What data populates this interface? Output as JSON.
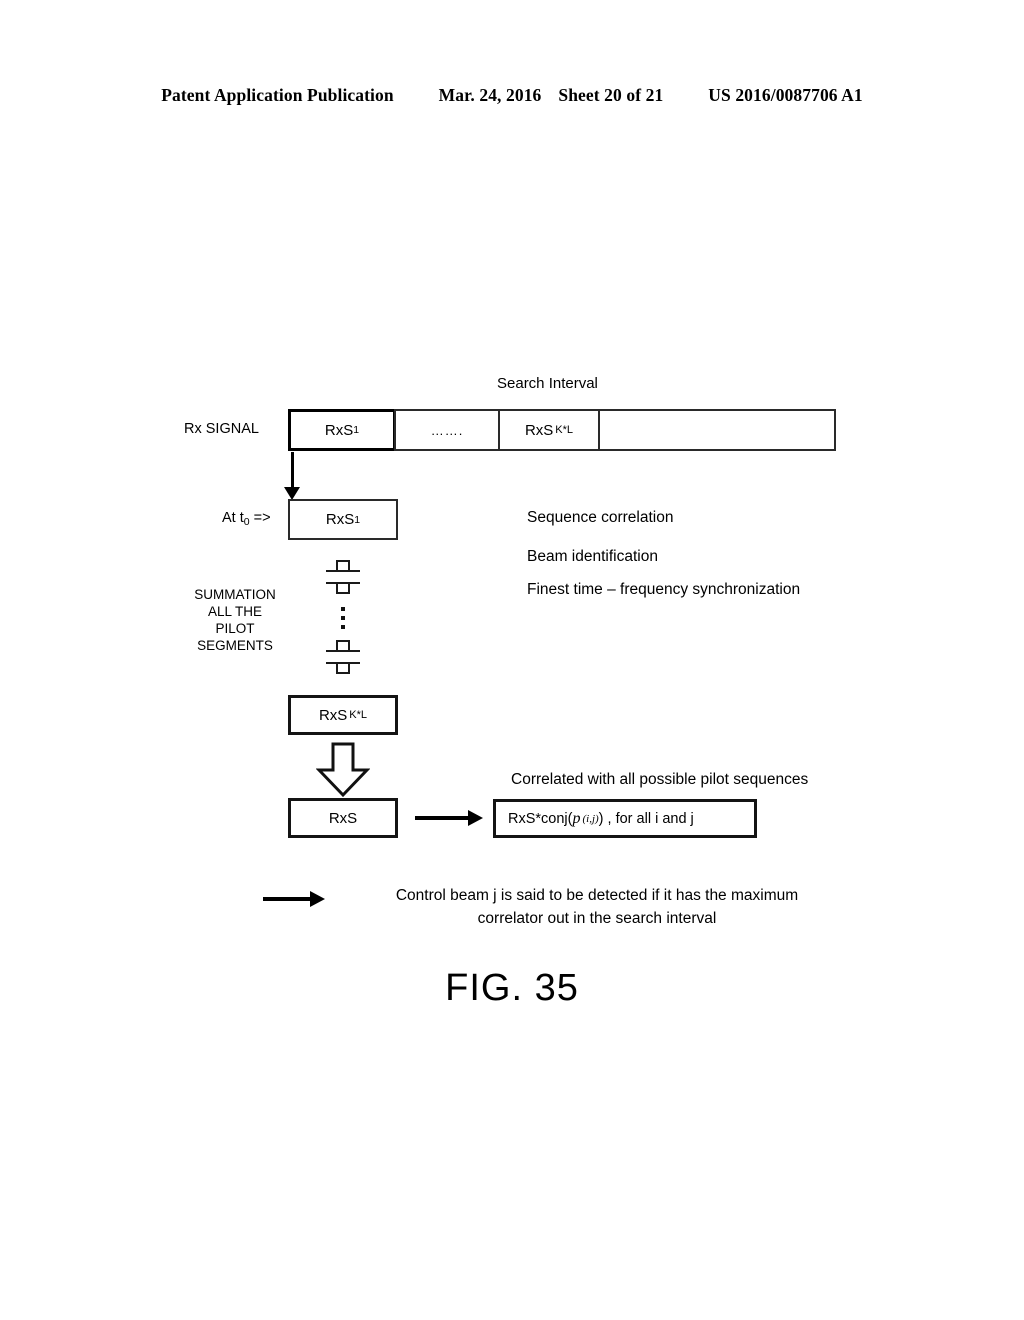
{
  "header": {
    "publication": "Patent Application Publication",
    "date": "Mar. 24, 2016",
    "sheet": "Sheet 20 of 21",
    "patent_number": "US 2016/0087706 A1"
  },
  "figure": {
    "caption": "FIG. 35",
    "search_interval_label": "Search Interval",
    "rx_signal_label": "Rx SIGNAL",
    "at_t0_label": "At  t",
    "at_t0_sub": "0",
    "at_t0_suffix": " =>",
    "summation_label_lines": [
      "SUMMATION",
      "ALL THE",
      "PILOT",
      "SEGMENTS"
    ],
    "timeline_boxes": [
      {
        "base": "RxS",
        "sub": "1"
      },
      {
        "base": "…….",
        "sub": ""
      },
      {
        "base": "RxS",
        "sub": "K*L"
      },
      {
        "base": "",
        "sub": ""
      }
    ],
    "box_rxs1": {
      "base": "RxS",
      "sub": "1"
    },
    "box_rxskl": {
      "base": "RxS",
      "sub": "K*L"
    },
    "box_rxs": {
      "base": "RxS",
      "sub": ""
    },
    "right_notes": [
      "Sequence correlation",
      "Beam identification",
      "Finest time – frequency synchronization"
    ],
    "correlated_note": "Correlated with all possible pilot sequences",
    "formula": {
      "prefix": "RxS*conj( ",
      "variable": "p",
      "superscript": "(i,j)",
      "suffix": " ) , for all i and j"
    },
    "conclusion_lines": [
      "Control beam j is said to be detected if it has the maximum",
      "correlator out in the search interval"
    ]
  },
  "colors": {
    "ink": "#000000",
    "paper": "#ffffff"
  }
}
